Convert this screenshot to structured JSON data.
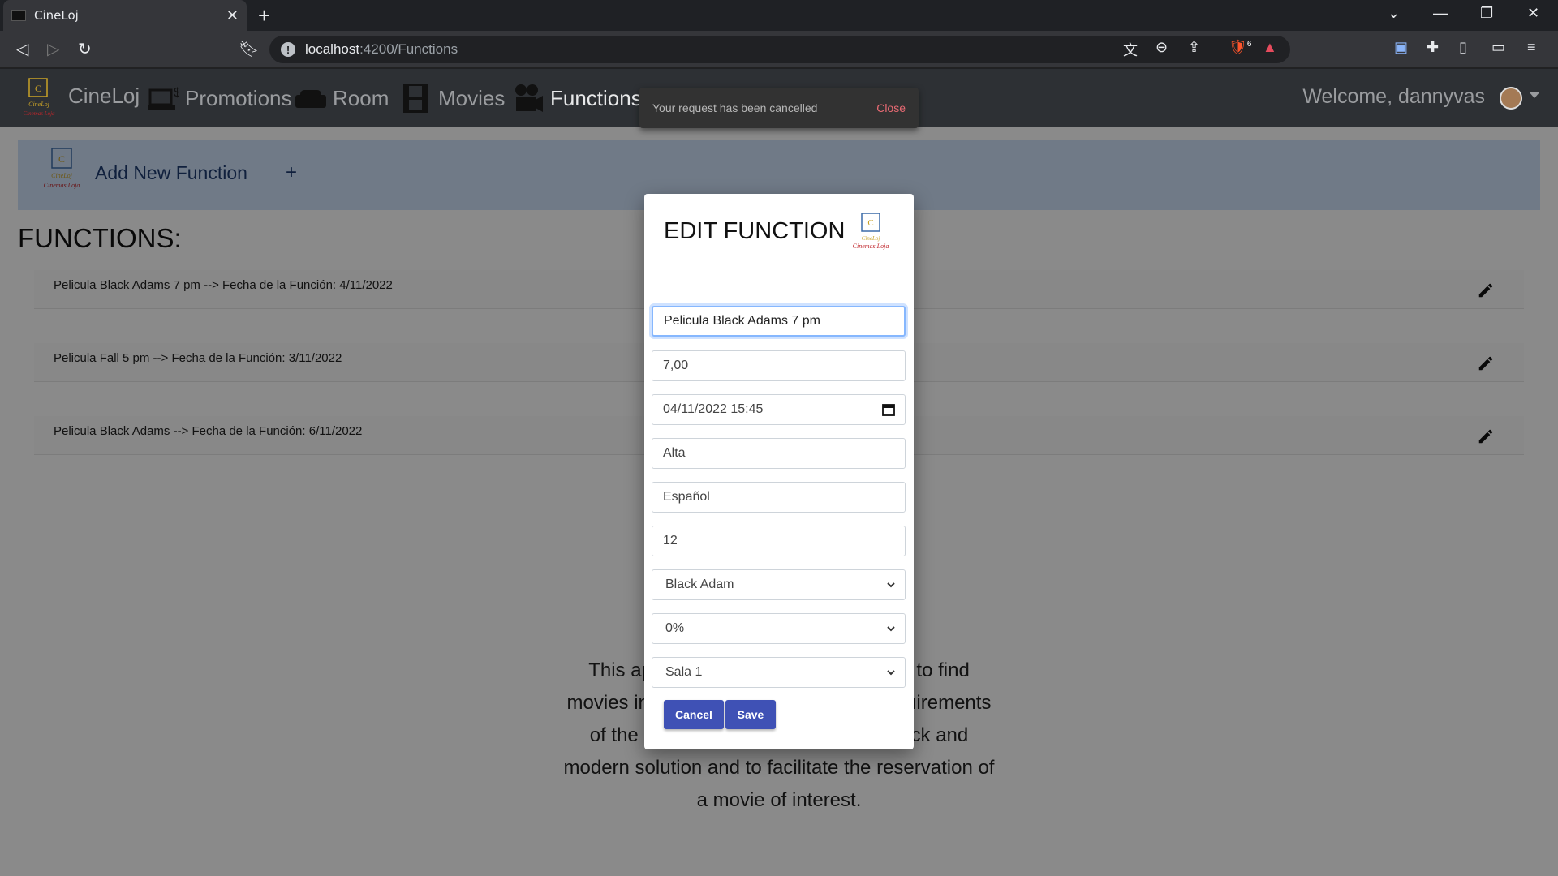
{
  "browser": {
    "tab_title": "CineLoj",
    "url_host": "localhost",
    "url_path": ":4200/Functions",
    "brave_badge": "6"
  },
  "nav": {
    "brand": "CineLoj",
    "links": [
      "Promotions",
      "Room",
      "Movies",
      "Functions"
    ],
    "welcome": "Welcome, dannyvas"
  },
  "page": {
    "add_label": "Add New Function",
    "add_plus": "+",
    "functions_title": "FUNCTIONS:",
    "functions": [
      "Pelicula Black Adams 7 pm --> Fecha de la Función: 4/11/2022",
      "Pelicula Fall 5 pm --> Fecha de la Función: 3/11/2022",
      "Pelicula Black Adams --> Fecha de la Función: 6/11/2022"
    ],
    "about_text": "This app is intended to make it easier to find movies in cinemas and to cover the requirements of the National Cinema, offering a quick and modern solution and to facilitate the reservation of a movie of interest."
  },
  "snackbar": {
    "message": "Your request has been cancelled",
    "action": "Close"
  },
  "dialog": {
    "title": "EDIT FUNCTION",
    "name_value": "Pelicula Black Adams 7 pm",
    "price_value": "7,00",
    "datetime_value": "04/11/2022 15:45",
    "demand_value": "Alta",
    "language_value": "Español",
    "capacity_value": "12",
    "movie_selected": "Black Adam",
    "promotion_selected": "0%",
    "room_selected": "Sala 1",
    "cancel_label": "Cancel",
    "save_label": "Save"
  },
  "colors": {
    "primary_button": "#3f51b5",
    "navbar": "#2d3034",
    "add_bar": "#cfe2f9",
    "snack_action": "#e86a73"
  }
}
